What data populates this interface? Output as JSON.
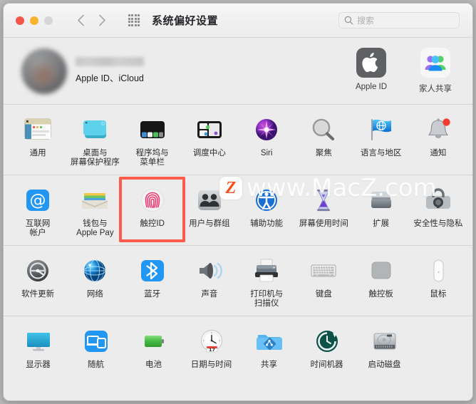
{
  "window": {
    "title": "系统偏好设置",
    "traffic_lights": [
      {
        "name": "close",
        "color": "#f3564c"
      },
      {
        "name": "minimize",
        "color": "#f7b32b"
      },
      {
        "name": "zoom",
        "color": "#d6d6d6"
      }
    ],
    "nav": {
      "back": "‹",
      "forward": "›"
    },
    "grid_button": "show-all-grid"
  },
  "search": {
    "placeholder": "搜索",
    "value": "",
    "icon": "search-icon"
  },
  "account": {
    "name": "",
    "name_redacted": true,
    "subtitle": "Apple ID、iCloud",
    "avatar": "user-avatar-blurred",
    "shortcuts": [
      {
        "label": "Apple ID",
        "icon": "apple-logo-icon"
      },
      {
        "label": "家人共享",
        "icon": "family-sharing-icon"
      }
    ]
  },
  "highlight": {
    "target": "触控ID",
    "color": "#fd5b4b"
  },
  "watermark": {
    "badge": "Z",
    "text": "www.MacZ.com"
  },
  "sections": [
    {
      "name": "section-system",
      "items": [
        {
          "label": "通用",
          "icon": "general-icon"
        },
        {
          "label": "桌面与\n屏幕保护程序",
          "icon": "desktop-screensaver-icon"
        },
        {
          "label": "程序坞与\n菜单栏",
          "icon": "dock-menubar-icon"
        },
        {
          "label": "调度中心",
          "icon": "mission-control-icon"
        },
        {
          "label": "Siri",
          "icon": "siri-icon"
        },
        {
          "label": "聚焦",
          "icon": "spotlight-icon"
        },
        {
          "label": "语言与地区",
          "icon": "language-region-icon"
        },
        {
          "label": "通知",
          "icon": "notifications-icon"
        }
      ]
    },
    {
      "name": "section-accounts",
      "items": [
        {
          "label": "互联网\n帐户",
          "icon": "internet-accounts-icon"
        },
        {
          "label": "钱包与\nApple Pay",
          "icon": "wallet-applepay-icon"
        },
        {
          "label": "触控ID",
          "icon": "touch-id-icon"
        },
        {
          "label": "用户与群组",
          "icon": "users-groups-icon"
        },
        {
          "label": "辅助功能",
          "icon": "accessibility-icon"
        },
        {
          "label": "屏幕使用时间",
          "icon": "screen-time-icon"
        },
        {
          "label": "扩展",
          "icon": "extensions-icon"
        },
        {
          "label": "安全性与隐私",
          "icon": "security-privacy-icon"
        }
      ]
    },
    {
      "name": "section-hardware",
      "items": [
        {
          "label": "软件更新",
          "icon": "software-update-icon"
        },
        {
          "label": "网络",
          "icon": "network-icon"
        },
        {
          "label": "蓝牙",
          "icon": "bluetooth-icon"
        },
        {
          "label": "声音",
          "icon": "sound-icon"
        },
        {
          "label": "打印机与\n扫描仪",
          "icon": "printers-scanners-icon"
        },
        {
          "label": "键盘",
          "icon": "keyboard-icon"
        },
        {
          "label": "触控板",
          "icon": "trackpad-icon"
        },
        {
          "label": "鼠标",
          "icon": "mouse-icon"
        }
      ]
    },
    {
      "name": "section-displays",
      "items": [
        {
          "label": "显示器",
          "icon": "displays-icon"
        },
        {
          "label": "随航",
          "icon": "sidecar-icon"
        },
        {
          "label": "电池",
          "icon": "battery-icon"
        },
        {
          "label": "日期与时间",
          "icon": "date-time-icon",
          "badge": "17"
        },
        {
          "label": "共享",
          "icon": "sharing-icon"
        },
        {
          "label": "时间机器",
          "icon": "time-machine-icon"
        },
        {
          "label": "启动磁盘",
          "icon": "startup-disk-icon"
        }
      ]
    }
  ]
}
